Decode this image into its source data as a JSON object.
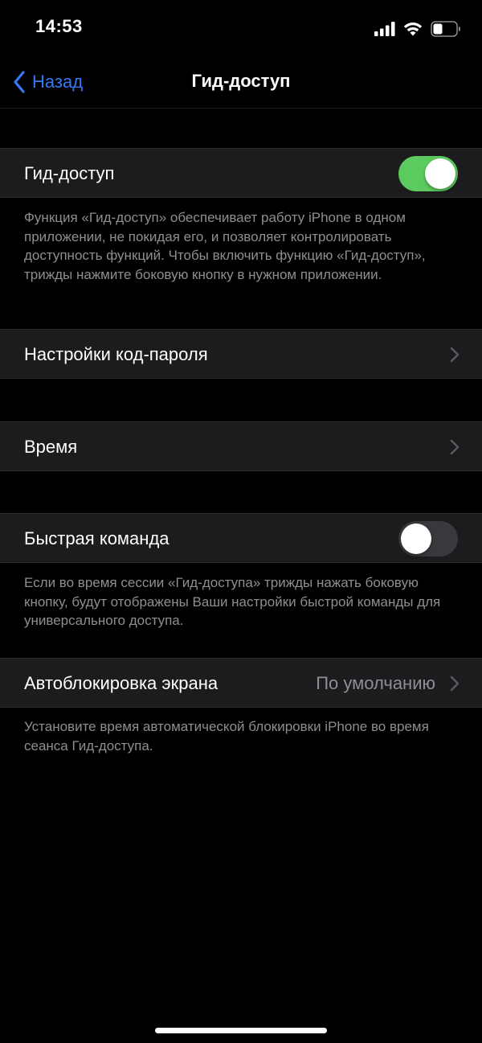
{
  "status_bar": {
    "time": "14:53",
    "icons": [
      "cellular-signal-icon",
      "wifi-icon",
      "battery-icon"
    ]
  },
  "nav": {
    "back_label": "Назад",
    "title": "Гид-доступ"
  },
  "guided_access": {
    "label": "Гид-доступ",
    "toggle_on": true,
    "footer": "Функция «Гид-доступ» обеспечивает работу iPhone в одном приложении, не покидая его, и позволяет контролировать доступность функций. Чтобы включить функцию «Гид-доступ», трижды нажмите боковую кнопку в нужном приложении."
  },
  "passcode_settings": {
    "label": "Настройки код-пароля"
  },
  "time_limits": {
    "label": "Время"
  },
  "accessibility_shortcut": {
    "label": "Быстрая команда",
    "toggle_on": false,
    "footer": "Если во время сессии «Гид-доступа» трижды нажать боковую кнопку, будут отображены Ваши настройки быстрой команды для универсального доступа."
  },
  "auto_lock": {
    "label": "Автоблокировка экрана",
    "value": "По умолчанию",
    "footer": "Установите время автоматической блокировки iPhone во время сеанса Гид-доступа."
  },
  "colors": {
    "background": "#000000",
    "cell_background": "#1c1c1e",
    "accent_blue": "#3478f6",
    "toggle_on_green": "#5ccb5f",
    "secondary_text": "#8e8e93"
  }
}
